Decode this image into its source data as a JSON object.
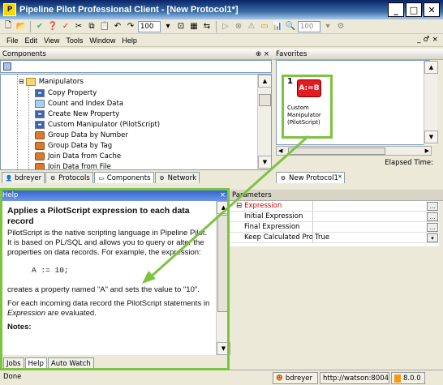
{
  "window": {
    "title": "Pipeline Pilot Professional Client - [New Protocol1*]"
  },
  "toolbar": {
    "zoom1": "100",
    "zoom2": "100"
  },
  "menu": {
    "items": [
      "File",
      "Edit",
      "View",
      "Tools",
      "Window",
      "Help"
    ],
    "right": "_ ♂ ×"
  },
  "components": {
    "title": "Components",
    "pin": "⊕ ×",
    "tree": [
      {
        "label": "Manipulators",
        "icon": "folder-icon"
      },
      {
        "label": "Copy Property",
        "icon": "component-icon"
      },
      {
        "label": "Count and Index Data",
        "icon": "component-icon"
      },
      {
        "label": "Create New Property",
        "icon": "component-icon"
      },
      {
        "label": "Custom Manipulator (PilotScript)",
        "icon": "component-icon"
      },
      {
        "label": "Group Data by Number",
        "icon": "group-icon"
      },
      {
        "label": "Group Data by Tag",
        "icon": "group-icon"
      },
      {
        "label": "Join Data from Cache",
        "icon": "group-icon"
      },
      {
        "label": "Join Data from File",
        "icon": "group-icon"
      }
    ],
    "tabs": [
      "bdreyer",
      "Protocols",
      "Components",
      "Network"
    ]
  },
  "favorites": {
    "title": "Favorites",
    "badge": "1",
    "block_label": "A:=B",
    "item_label": "Custom Manipulator (PilotScript)",
    "elapsed": "Elapsed Time:",
    "tab": "New Protocol1*"
  },
  "help": {
    "title": "Help",
    "heading": "Applies a PilotScript expression to each data record",
    "p1": "PilotScript is the native scripting language in Pipeline Pilot. It is based on PL/SQL and allows you to query or alter the properties on data records. For example, the expression:",
    "code": "A := 10;",
    "p2": "creates a property named \"A\" and sets the value to \"10\".",
    "p3a": "For each incoming data record the PilotScript statements in ",
    "p3b": "Expression",
    "p3c": " are evaluated.",
    "notes": "Notes:",
    "tabs": [
      "Jobs",
      "Help",
      "Auto Watch"
    ]
  },
  "parameters": {
    "title": "Parameters",
    "rows": [
      {
        "name": "Expression",
        "value": ""
      },
      {
        "name": "Initial Expression",
        "value": ""
      },
      {
        "name": "Final Expression",
        "value": ""
      },
      {
        "name": "Keep Calculated Prop",
        "value": "True"
      }
    ]
  },
  "status": {
    "left": "Done",
    "user": "bdreyer",
    "server": "http://watson:8004",
    "version": "8.0.0"
  },
  "colors": {
    "highlight": "#7ec242",
    "title_blue": "#0a246a",
    "expression_red": "#cc0000"
  }
}
